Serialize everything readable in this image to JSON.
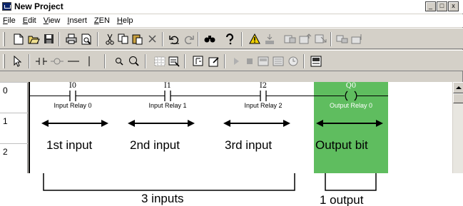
{
  "window": {
    "title": "New Project",
    "controls": [
      "_",
      "□",
      "x"
    ]
  },
  "menu": [
    {
      "accel": "F",
      "rest": "ile"
    },
    {
      "accel": "E",
      "rest": "dit"
    },
    {
      "accel": "V",
      "rest": "iew"
    },
    {
      "accel": "I",
      "rest": "nsert"
    },
    {
      "accel": "Z",
      "rest": "EN"
    },
    {
      "accel": "H",
      "rest": "elp"
    }
  ],
  "toolbar_icons": {
    "row1": [
      "new-file-icon",
      "open-folder-icon",
      "save-icon",
      "print-icon",
      "print-preview-icon",
      "cut-icon",
      "copy-icon",
      "paste-icon",
      "delete-icon",
      "undo-icon",
      "redo-icon",
      "find-icon",
      "help-icon",
      "warning-icon",
      "transfer-icon",
      "compare-icon",
      "upload-icon",
      "download-icon",
      "monitor-icon",
      "settings-icon"
    ],
    "row2": [
      "select-icon",
      "insert-contact-icon",
      "insert-function-icon",
      "horizontal-line-icon",
      "vertical-line-icon",
      "zoom-in-icon",
      "zoom-out-icon",
      "grid-icon",
      "comments-icon",
      "connect-icon",
      "edit-icon",
      "run-icon",
      "stop-icon",
      "program-mode-icon",
      "monitor-mode-icon",
      "timer-icon",
      "io-list-icon"
    ]
  },
  "rungs": [
    "0",
    "1",
    "2"
  ],
  "contacts": [
    {
      "address": "I0",
      "comment": "Input Relay 0",
      "description": "1st input"
    },
    {
      "address": "I1",
      "comment": "Input Relay 1",
      "description": "2nd input"
    },
    {
      "address": "I2",
      "comment": "Input Relay 2",
      "description": "3rd input"
    }
  ],
  "output": {
    "address": "Q0",
    "comment": "Output Relay 0",
    "description": "Output bit"
  },
  "annotations": {
    "inputs_note": "3 inputs",
    "output_note": "1 output"
  },
  "colors": {
    "output_highlight": "#5fbd5f",
    "window_face": "#d4d0c8"
  }
}
